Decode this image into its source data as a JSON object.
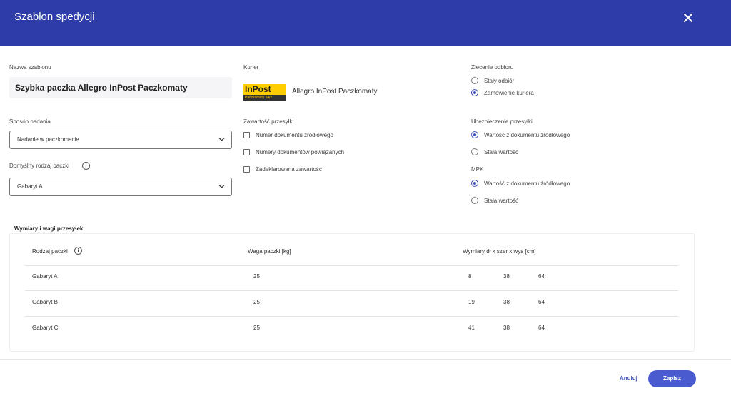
{
  "header": {
    "title": "Szablon spedycji",
    "close_icon": "close-icon"
  },
  "form": {
    "template_name": {
      "label": "Nazwa szablonu",
      "value": "Szybka paczka Allegro InPost Paczkomaty"
    },
    "shipping_method": {
      "label": "Sposób nadania",
      "value": "Nadanie w paczkomacie"
    },
    "default_package": {
      "label": "Domyślny rodzaj paczki",
      "value": "Gabaryt A",
      "info_icon": "info-icon"
    },
    "courier": {
      "label": "Kurier",
      "logo_text": "InPost",
      "logo_subtext": "Paczkomaty 24/7",
      "name": "Allegro InPost Paczkomaty"
    },
    "contents": {
      "label": "Zawartość przesyłki",
      "options": [
        {
          "label": "Numer dokumentu źródłowego",
          "checked": false
        },
        {
          "label": "Numery dokumentów powiązanych",
          "checked": false
        },
        {
          "label": "Zadeklarowana zawartość",
          "checked": false
        }
      ]
    },
    "pickup_order": {
      "label": "Zlecenie odbioru",
      "options": [
        {
          "label": "Stały odbiór",
          "selected": false
        },
        {
          "label": "Zamówienie kuriera",
          "selected": true
        }
      ]
    },
    "insurance": {
      "label": "Ubezpieczenie przesyłki",
      "options": [
        {
          "label": "Wartość z dokumentu źródłowego",
          "selected": true
        },
        {
          "label": "Stała wartość",
          "selected": false
        }
      ]
    },
    "mpk": {
      "label": "MPK",
      "options": [
        {
          "label": "Wartość z dokumentu źródłowego",
          "selected": true
        },
        {
          "label": "Stała wartość",
          "selected": false
        }
      ]
    }
  },
  "dimensions": {
    "title": "Wymiary i wagi przesyłek",
    "columns": [
      "Rodzaj paczki",
      "Waga paczki [kg]",
      "Wymiary dł x szer x wys [cm]"
    ],
    "rows": [
      {
        "type": "Gabaryt A",
        "weight": "25",
        "length": "8",
        "width": "38",
        "height": "64"
      },
      {
        "type": "Gabaryt B",
        "weight": "25",
        "length": "19",
        "width": "38",
        "height": "64"
      },
      {
        "type": "Gabaryt C",
        "weight": "25",
        "length": "41",
        "width": "38",
        "height": "64"
      }
    ]
  },
  "footer": {
    "cancel_label": "Anuluj",
    "save_label": "Zapisz"
  },
  "colors": {
    "header": "#2d3ca8",
    "accent": "#3f51b5",
    "save_button": "#4a5bd0",
    "inpost_yellow": "#ffcd00"
  }
}
